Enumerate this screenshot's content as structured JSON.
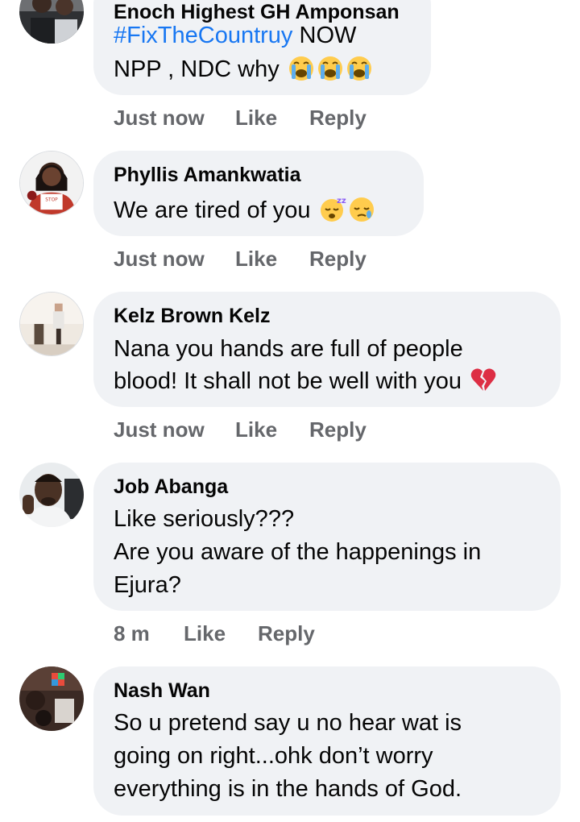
{
  "comments": [
    {
      "author": "Enoch Highest GH Amponsan",
      "line1_hashtag": "#FixTheCountruy",
      "line1_rest": " NOW",
      "line2": "NPP , NDC why",
      "emojis": [
        "loudly-crying-face-emoji",
        "loudly-crying-face-emoji",
        "loudly-crying-face-emoji"
      ],
      "time": "Just now",
      "like": "Like",
      "reply": "Reply"
    },
    {
      "author": "Phyllis Amankwatia",
      "line1": "We are tired of you",
      "emojis": [
        "sleeping-face-emoji",
        "sleepy-face-emoji"
      ],
      "time": "Just now",
      "like": "Like",
      "reply": "Reply"
    },
    {
      "author": "Kelz Brown Kelz",
      "line1": "Nana you hands are full of people",
      "line2": "blood! It shall not be well with you",
      "emojis": [
        "broken-heart-emoji"
      ],
      "time": "Just now",
      "like": "Like",
      "reply": "Reply"
    },
    {
      "author": "Job Abanga",
      "line1": "Like seriously???",
      "line2": "Are you aware of the happenings in",
      "line3": "Ejura?",
      "time": "8 m",
      "like": "Like",
      "reply": "Reply"
    },
    {
      "author": "Nash Wan",
      "line1": "So u pretend say u no hear wat is",
      "line2": "going on right...ohk don’t worry",
      "line3": "everything is in the hands of God."
    }
  ],
  "colors": {
    "bubble": "#f0f2f5",
    "link": "#1877f2",
    "meta": "#65676b",
    "text": "#050505"
  }
}
